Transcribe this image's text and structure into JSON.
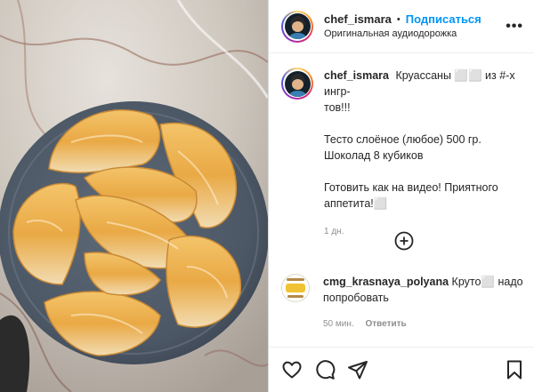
{
  "post": {
    "username": "chef_ismara",
    "separator": "•",
    "follow_label": "Подписаться",
    "audio_label": "Оригинальная аудиодорожка",
    "more_label": "•••"
  },
  "caption": {
    "username": "chef_ismara",
    "line1": "Круассаны ⬜⬜ из #-х ингр-",
    "line2": "тов!!!",
    "line3": "Тесто слоёное (любое) 500 гр.",
    "line4": "Шоколад 8 кубиков",
    "line5": "Готовить как на видео! Приятного",
    "line6": "аппетита!⬜",
    "time": "1 дн."
  },
  "comment": {
    "username": "cmg_krasnaya_polyana",
    "text_line1": "Круто⬜ надо",
    "text_line2": "попробовать",
    "time": "50 мин.",
    "reply_label": "Ответить"
  },
  "icons": {
    "more_comments": "plus-circle-icon",
    "like": "heart-icon",
    "comment": "comment-icon",
    "share": "share-icon",
    "save": "bookmark-icon"
  },
  "colors": {
    "accent": "#0095f6",
    "text": "#262626",
    "muted": "#8e8e8e"
  }
}
